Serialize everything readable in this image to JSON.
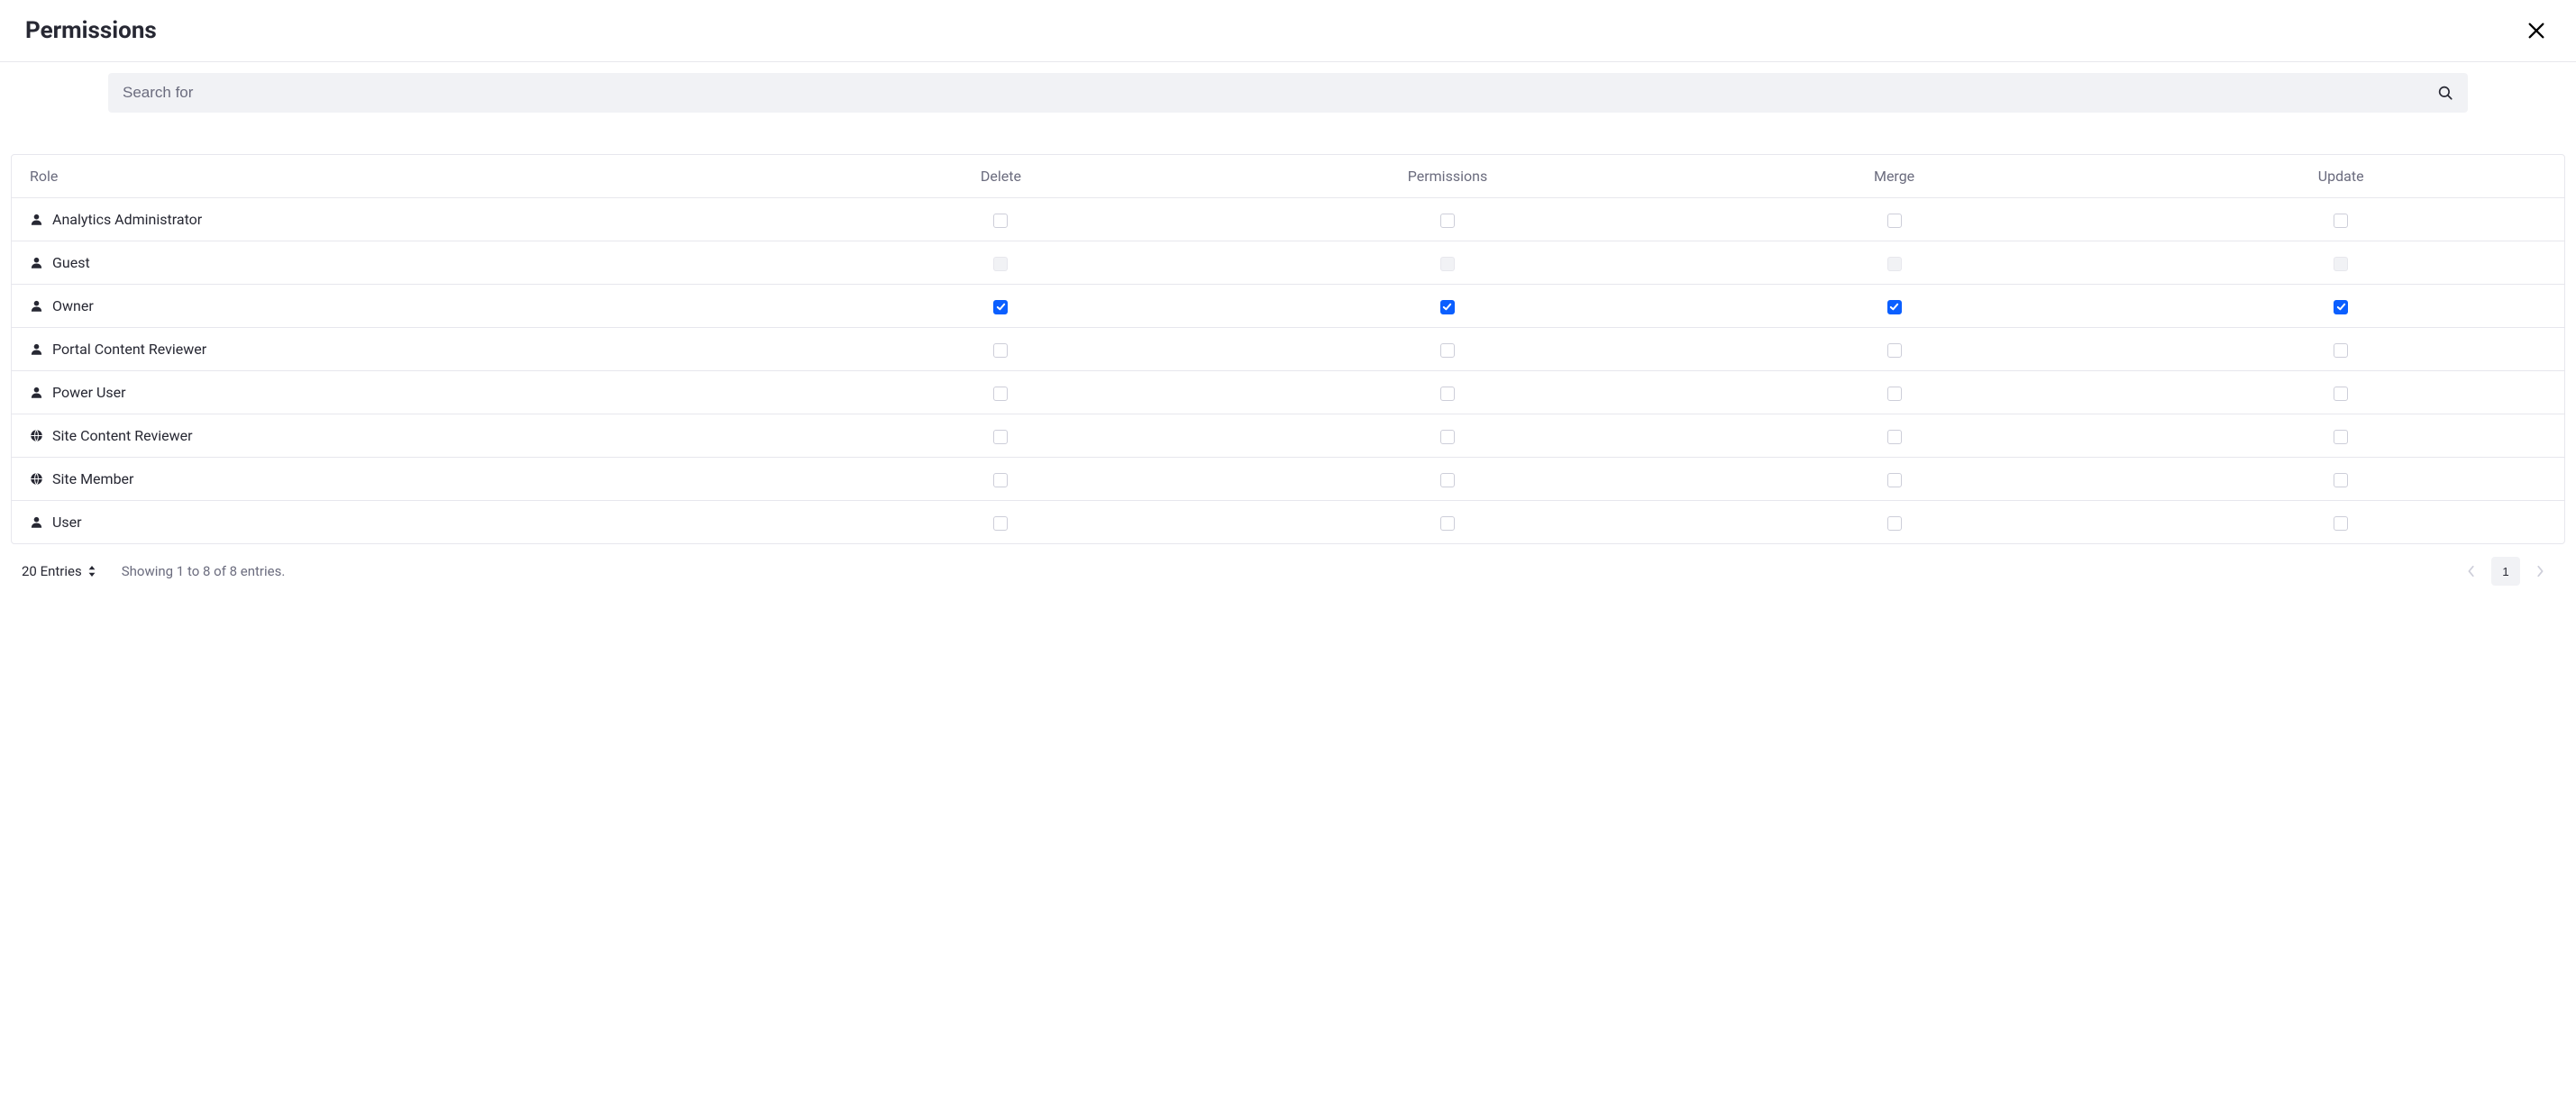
{
  "header": {
    "title": "Permissions"
  },
  "search": {
    "placeholder": "Search for",
    "value": ""
  },
  "table": {
    "columns": [
      "Role",
      "Delete",
      "Permissions",
      "Merge",
      "Update"
    ],
    "rows": [
      {
        "icon": "user",
        "label": "Analytics Administrator",
        "cells": [
          {
            "checked": false,
            "disabled": false
          },
          {
            "checked": false,
            "disabled": false
          },
          {
            "checked": false,
            "disabled": false
          },
          {
            "checked": false,
            "disabled": false
          }
        ]
      },
      {
        "icon": "user",
        "label": "Guest",
        "cells": [
          {
            "checked": false,
            "disabled": true
          },
          {
            "checked": false,
            "disabled": true
          },
          {
            "checked": false,
            "disabled": true
          },
          {
            "checked": false,
            "disabled": true
          }
        ]
      },
      {
        "icon": "user",
        "label": "Owner",
        "cells": [
          {
            "checked": true,
            "disabled": false
          },
          {
            "checked": true,
            "disabled": false
          },
          {
            "checked": true,
            "disabled": false
          },
          {
            "checked": true,
            "disabled": false
          }
        ]
      },
      {
        "icon": "user",
        "label": "Portal Content Reviewer",
        "cells": [
          {
            "checked": false,
            "disabled": false
          },
          {
            "checked": false,
            "disabled": false
          },
          {
            "checked": false,
            "disabled": false
          },
          {
            "checked": false,
            "disabled": false
          }
        ]
      },
      {
        "icon": "user",
        "label": "Power User",
        "cells": [
          {
            "checked": false,
            "disabled": false
          },
          {
            "checked": false,
            "disabled": false
          },
          {
            "checked": false,
            "disabled": false
          },
          {
            "checked": false,
            "disabled": false
          }
        ]
      },
      {
        "icon": "globe",
        "label": "Site Content Reviewer",
        "cells": [
          {
            "checked": false,
            "disabled": false
          },
          {
            "checked": false,
            "disabled": false
          },
          {
            "checked": false,
            "disabled": false
          },
          {
            "checked": false,
            "disabled": false
          }
        ]
      },
      {
        "icon": "globe",
        "label": "Site Member",
        "cells": [
          {
            "checked": false,
            "disabled": false
          },
          {
            "checked": false,
            "disabled": false
          },
          {
            "checked": false,
            "disabled": false
          },
          {
            "checked": false,
            "disabled": false
          }
        ]
      },
      {
        "icon": "user",
        "label": "User",
        "cells": [
          {
            "checked": false,
            "disabled": false
          },
          {
            "checked": false,
            "disabled": false
          },
          {
            "checked": false,
            "disabled": false
          },
          {
            "checked": false,
            "disabled": false
          }
        ]
      }
    ]
  },
  "footer": {
    "entries_label": "20 Entries",
    "showing_text": "Showing 1 to 8 of 8 entries.",
    "current_page": "1"
  }
}
